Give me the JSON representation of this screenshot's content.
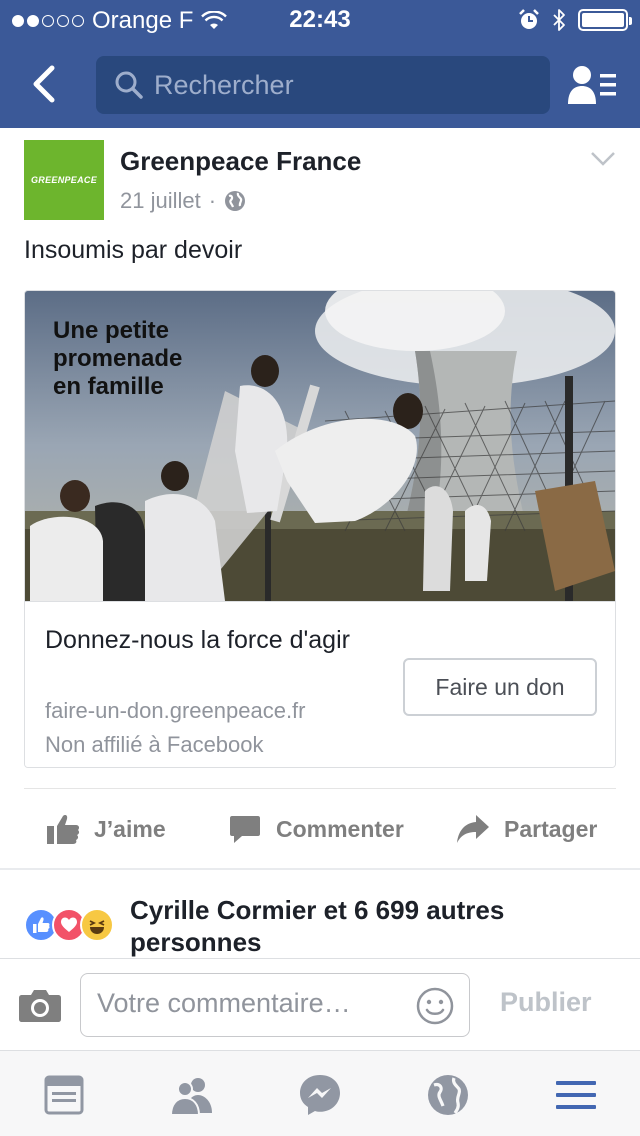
{
  "status_bar": {
    "carrier": "Orange F",
    "time": "22:43",
    "battery_level": 1.0
  },
  "nav": {
    "search_placeholder": "Rechercher"
  },
  "post": {
    "author": "Greenpeace France",
    "logo_text": "GREENPEACE",
    "date": "21 juillet",
    "separator": "·",
    "text": "Insoumis par devoir"
  },
  "link_card": {
    "image_caption": "Une petite\npromenade\nen famille",
    "title": "Donnez-nous la force d'agir",
    "domain": "faire-un-don.greenpeace.fr",
    "affiliation": "Non affilié à Facebook",
    "cta_label": "Faire un don"
  },
  "actions": {
    "like": "J’aime",
    "comment": "Commenter",
    "share": "Partager"
  },
  "reactions": {
    "summary": "Cyrille Cormier et 6 699 autres personnes"
  },
  "composer": {
    "placeholder": "Votre commentaire…",
    "publish": "Publier"
  },
  "colors": {
    "brand": "#3b5998",
    "greenpeace": "#6db52d"
  },
  "icons": {
    "tabs": [
      "news-feed-icon",
      "friends-icon",
      "messenger-icon",
      "globe-icon",
      "menu-icon"
    ]
  }
}
